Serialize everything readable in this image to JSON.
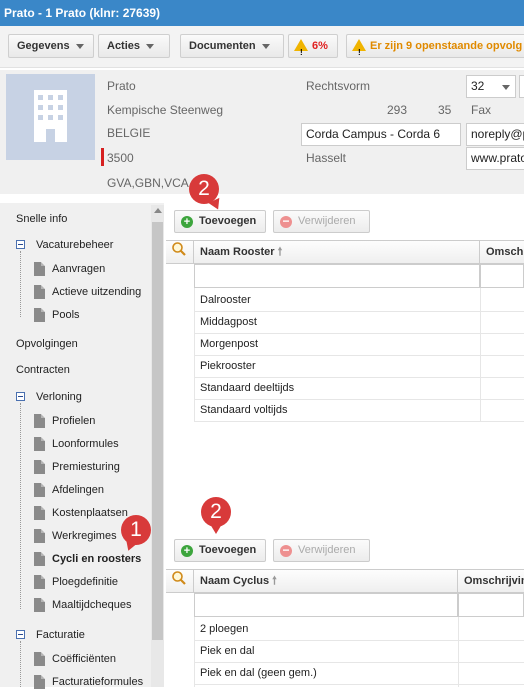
{
  "window": {
    "title": "Prato - 1 Prato (klnr: 27639)"
  },
  "toolbar": {
    "gegevens": "Gegevens",
    "acties": "Acties",
    "documenten": "Documenten",
    "warning_pct": "6%",
    "openstaande": "Er zijn 9 openstaande opvolg"
  },
  "company": {
    "name": "Prato",
    "street": "Kempische Steenweg",
    "number": "293",
    "bus": "35",
    "country": "BELGIE",
    "postcode": "3500",
    "codes": "GVA,GBN,VCA",
    "rechtsvorm_label": "Rechtsvorm",
    "rechtsvorm_value": "32",
    "fax_label": "Fax",
    "building": "Corda Campus - Corda 6",
    "city": "Hasselt",
    "email": "noreply@p",
    "website": "www.prato"
  },
  "sidebar": {
    "snelle_info": "Snelle info",
    "vacaturebeheer": "Vacaturebeheer",
    "aanvragen": "Aanvragen",
    "actieve_uitzending": "Actieve uitzending",
    "pools": "Pools",
    "opvolgingen": "Opvolgingen",
    "contracten": "Contracten",
    "verloning": "Verloning",
    "profielen": "Profielen",
    "loonformules": "Loonformules",
    "premiesturing": "Premiesturing",
    "afdelingen": "Afdelingen",
    "kostenplaatsen": "Kostenplaatsen",
    "werkregimes": "Werkregimes",
    "cycli_en_roosters": "Cycli en roosters",
    "ploegdefinitie": "Ploegdefinitie",
    "maaltijdcheques": "Maaltijdcheques",
    "facturatie": "Facturatie",
    "coefficienten": "Coëfficiënten",
    "facturatieformules": "Facturatieformules"
  },
  "roosters": {
    "add_label": "Toevoegen",
    "delete_label": "Verwijderen",
    "col_name": "Naam Rooster",
    "col_desc": "Omschr",
    "rows": [
      "Dalrooster",
      "Middagpost",
      "Morgenpost",
      "Piekrooster",
      "Standaard deeltijds",
      "Standaard voltijds"
    ]
  },
  "cycli": {
    "add_label": "Toevoegen",
    "delete_label": "Verwijderen",
    "col_name": "Naam Cyclus",
    "col_desc": "Omschrijvin",
    "rows": [
      "2 ploegen",
      "Piek en dal",
      "Piek en dal (geen gem.)"
    ]
  },
  "annotations": {
    "badge_1": "1",
    "badge_2a": "2",
    "badge_2b": "2"
  },
  "icons": [
    "building-icon",
    "warning-icon",
    "caret-down-icon",
    "plus-icon",
    "delete-icon",
    "search-icon",
    "sort-up-icon",
    "document-icon",
    "collapse-icon"
  ],
  "colors": {
    "titlebar": "#3a87c8",
    "badge": "#d83a3a",
    "add": "#3da53d",
    "warning": "#e02020"
  }
}
